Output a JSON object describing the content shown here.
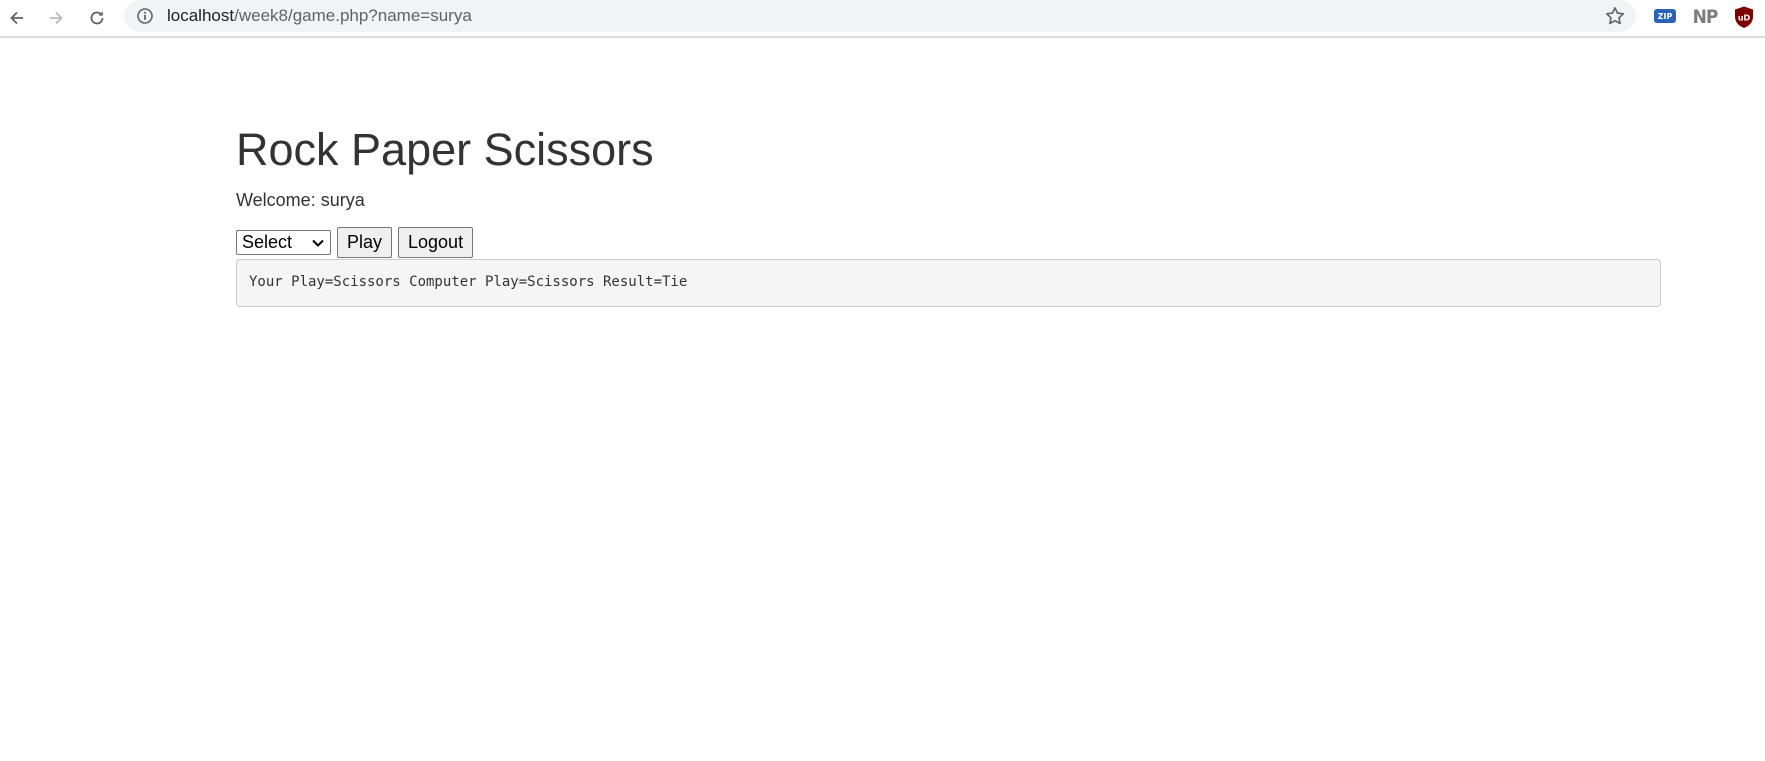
{
  "browser": {
    "url_host": "localhost",
    "url_path": "/week8/game.php?name=surya",
    "extensions": {
      "zip_label": "ZIP",
      "np_label": "NP",
      "ublock_label": "uD"
    },
    "icons": [
      "back-arrow-icon",
      "forward-arrow-icon",
      "reload-icon",
      "info-icon",
      "star-icon"
    ]
  },
  "page": {
    "title": "Rock Paper Scissors",
    "welcome": "Welcome: surya",
    "select": {
      "selected": "Select"
    },
    "play_label": "Play",
    "logout_label": "Logout",
    "result": "Your Play=Scissors Computer Play=Scissors Result=Tie"
  },
  "colors": {
    "text": "#333333",
    "result_bg": "#f5f5f5",
    "result_border": "#cccccc",
    "ublock": "#800000",
    "zip_ext": "#2b63b8"
  }
}
